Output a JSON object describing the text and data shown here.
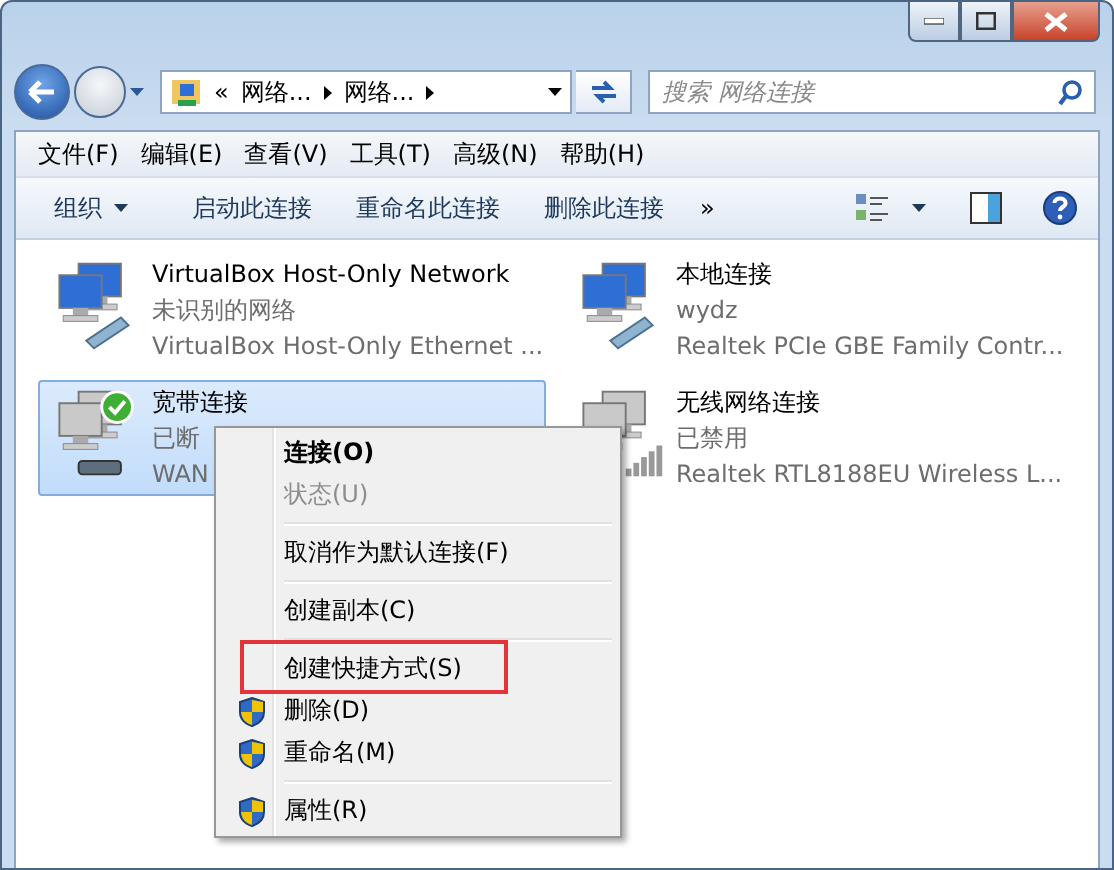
{
  "nav": {
    "crumbs": [
      "网络...",
      "网络..."
    ],
    "overflow": "«",
    "search": {
      "placeholder": "搜索 网络连接"
    }
  },
  "menu": [
    "文件(F)",
    "编辑(E)",
    "查看(V)",
    "工具(T)",
    "高级(N)",
    "帮助(H)"
  ],
  "toolbar": {
    "organize": "组织",
    "commands": [
      "启动此连接",
      "重命名此连接",
      "删除此连接"
    ],
    "more": "»"
  },
  "connections": [
    {
      "name": "VirtualBox Host-Only Network",
      "status": "未识别的网络",
      "device": "VirtualBox Host-Only Ethernet ...",
      "kind": "wired",
      "selected": false,
      "default": false
    },
    {
      "name": "本地连接",
      "status": "wydz",
      "device": "Realtek PCIe GBE Family Contr...",
      "kind": "wired",
      "selected": false,
      "default": false
    },
    {
      "name": "宽带连接",
      "status": "已断",
      "device": "WAN",
      "kind": "broadband",
      "selected": true,
      "default": true
    },
    {
      "name": "无线网络连接",
      "status": "已禁用",
      "device": "Realtek RTL8188EU Wireless L...",
      "kind": "wireless",
      "selected": false,
      "default": false
    }
  ],
  "context_menu": [
    {
      "kind": "item",
      "label": "连接(O)",
      "default": true,
      "disabled": false,
      "shield": false,
      "marked": false
    },
    {
      "kind": "item",
      "label": "状态(U)",
      "default": false,
      "disabled": true,
      "shield": false,
      "marked": false
    },
    {
      "kind": "separator"
    },
    {
      "kind": "item",
      "label": "取消作为默认连接(F)",
      "default": false,
      "disabled": false,
      "shield": false,
      "marked": false
    },
    {
      "kind": "separator"
    },
    {
      "kind": "item",
      "label": "创建副本(C)",
      "default": false,
      "disabled": false,
      "shield": false,
      "marked": false
    },
    {
      "kind": "separator"
    },
    {
      "kind": "item",
      "label": "创建快捷方式(S)",
      "default": false,
      "disabled": false,
      "shield": false,
      "marked": true
    },
    {
      "kind": "item",
      "label": "删除(D)",
      "default": false,
      "disabled": false,
      "shield": true,
      "marked": false
    },
    {
      "kind": "item",
      "label": "重命名(M)",
      "default": false,
      "disabled": false,
      "shield": true,
      "marked": false
    },
    {
      "kind": "separator"
    },
    {
      "kind": "item",
      "label": "属性(R)",
      "default": false,
      "disabled": false,
      "shield": true,
      "marked": false
    }
  ]
}
